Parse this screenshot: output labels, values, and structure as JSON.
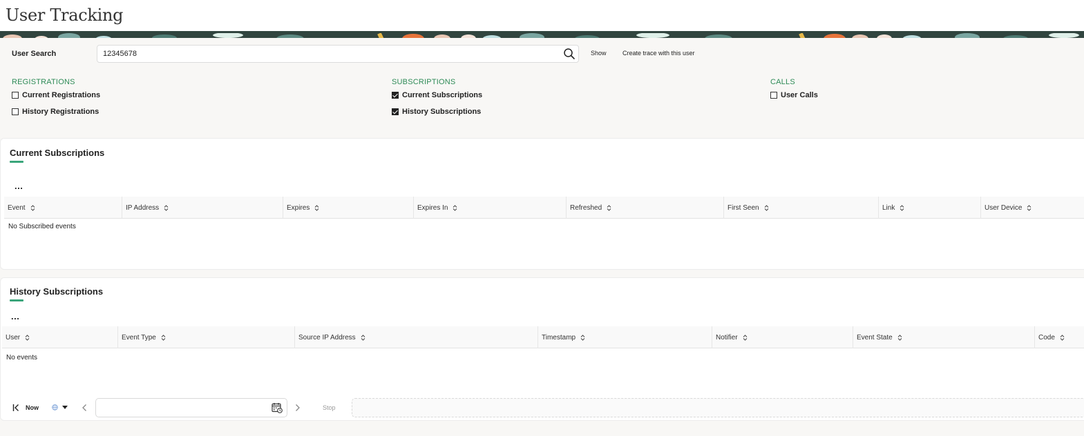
{
  "page": {
    "title": "User Tracking"
  },
  "search": {
    "label": "User Search",
    "value": "12345678",
    "show_label": "Show",
    "trace_label": "Create trace with this user"
  },
  "filters": {
    "registrations": {
      "title": "REGISTRATIONS",
      "current": {
        "label": "Current Registrations",
        "checked": false
      },
      "history": {
        "label": "History Registrations",
        "checked": false
      }
    },
    "subscriptions": {
      "title": "SUBSCRIPTIONS",
      "current": {
        "label": "Current Subscriptions",
        "checked": true
      },
      "history": {
        "label": "History Subscriptions",
        "checked": true
      }
    },
    "calls": {
      "title": "CALLS",
      "user_calls": {
        "label": "User Calls",
        "checked": false
      }
    }
  },
  "current_subscriptions": {
    "title": "Current Subscriptions",
    "more": "...",
    "columns": [
      "Event",
      "IP Address",
      "Expires",
      "Expires In",
      "Refreshed",
      "First Seen",
      "Link",
      "User Device"
    ],
    "empty": "No Subscribed events"
  },
  "history_subscriptions": {
    "title": "History Subscriptions",
    "more": "...",
    "columns": [
      "User",
      "Event Type",
      "Source IP Address",
      "Timestamp",
      "Notifier",
      "Event State",
      "Code"
    ],
    "empty": "No events"
  },
  "toolbar": {
    "now_label": "Now",
    "stop_label": "Stop",
    "date_value": ""
  },
  "colors": {
    "accent_green": "#2e8b57",
    "underline_green": "#3aa57a",
    "banner_dark": "#31453f"
  }
}
